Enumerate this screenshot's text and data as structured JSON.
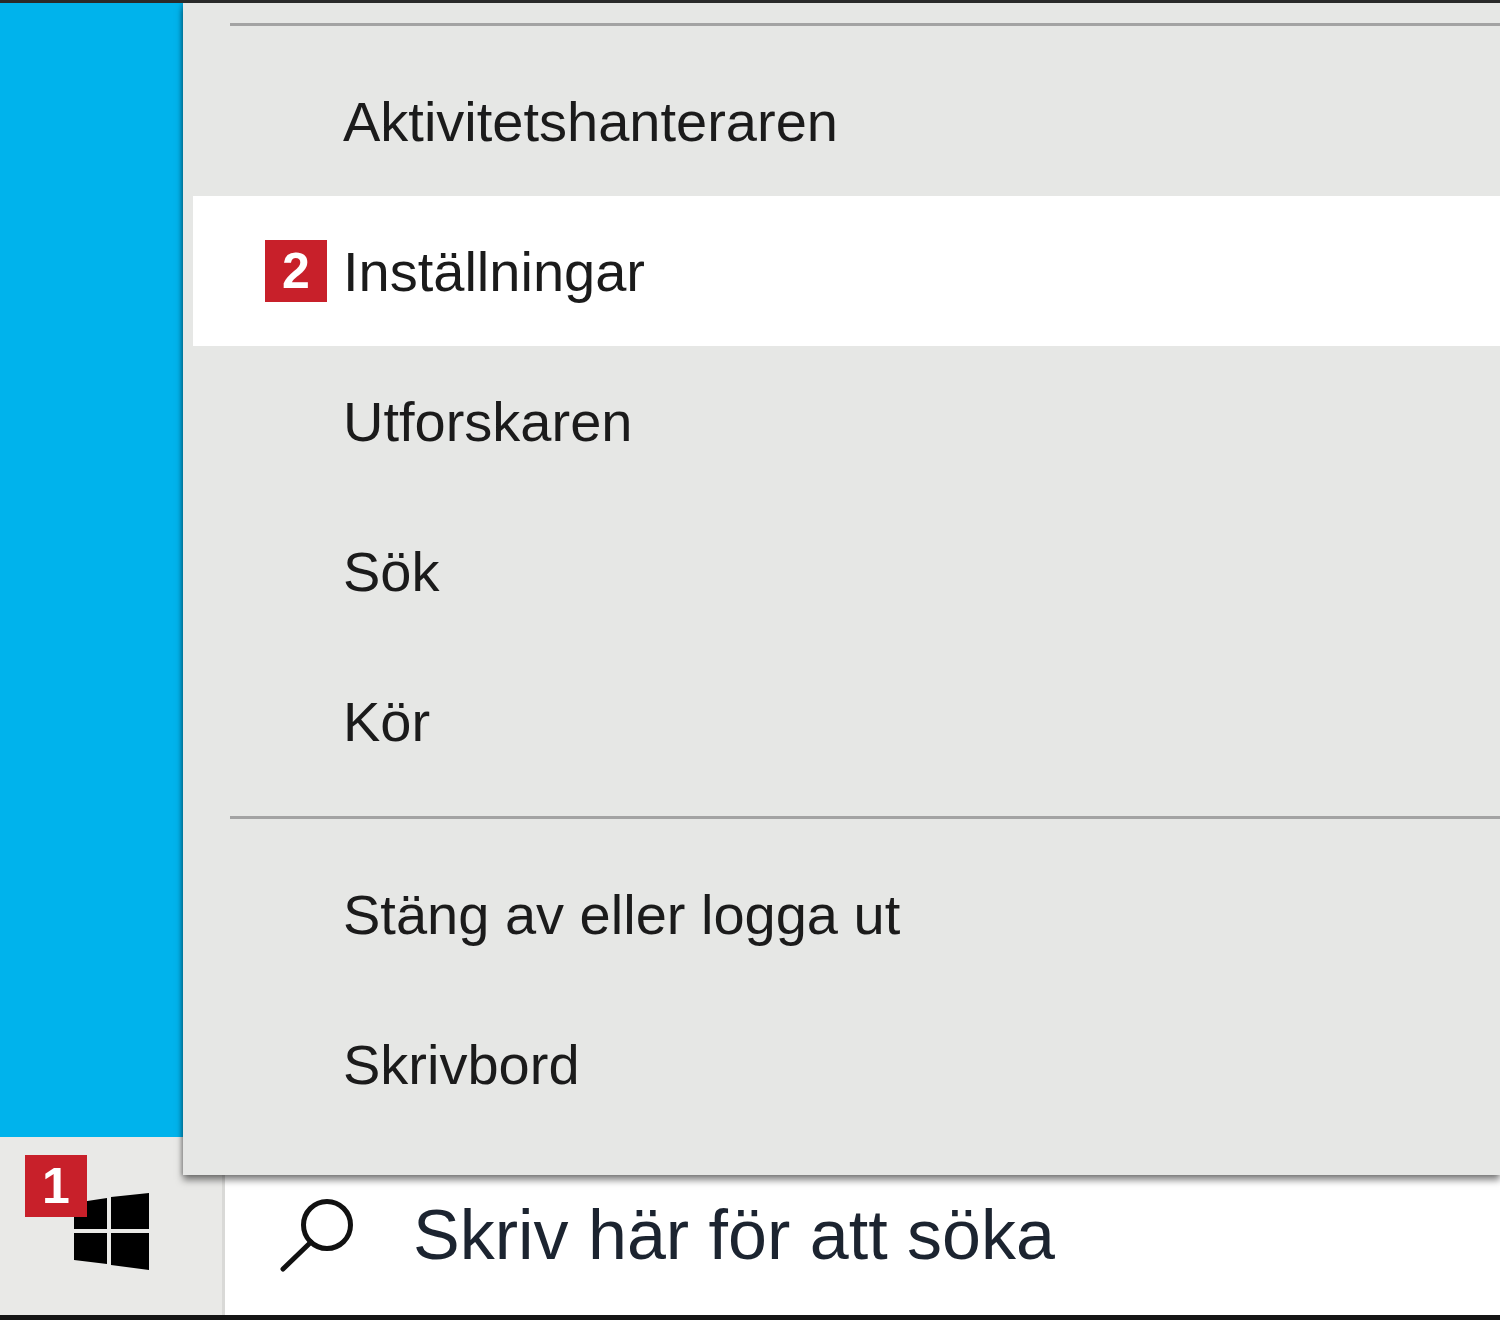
{
  "menu": {
    "items": [
      {
        "kind": "separator"
      },
      {
        "kind": "item",
        "label": "Aktivitetshanteraren",
        "selected": false
      },
      {
        "kind": "item",
        "label": "Inställningar",
        "selected": true,
        "step_badge": "2"
      },
      {
        "kind": "item",
        "label": "Utforskaren",
        "selected": false
      },
      {
        "kind": "item",
        "label": "Sök",
        "selected": false
      },
      {
        "kind": "item",
        "label": "Kör",
        "selected": false
      },
      {
        "kind": "separator"
      },
      {
        "kind": "item",
        "label": "Stäng av eller logga ut",
        "selected": false
      },
      {
        "kind": "item",
        "label": "Skrivbord",
        "selected": false
      }
    ]
  },
  "taskbar": {
    "start_button": {
      "step_badge": "1"
    },
    "search": {
      "placeholder": "Skriv här för att söka"
    }
  }
}
